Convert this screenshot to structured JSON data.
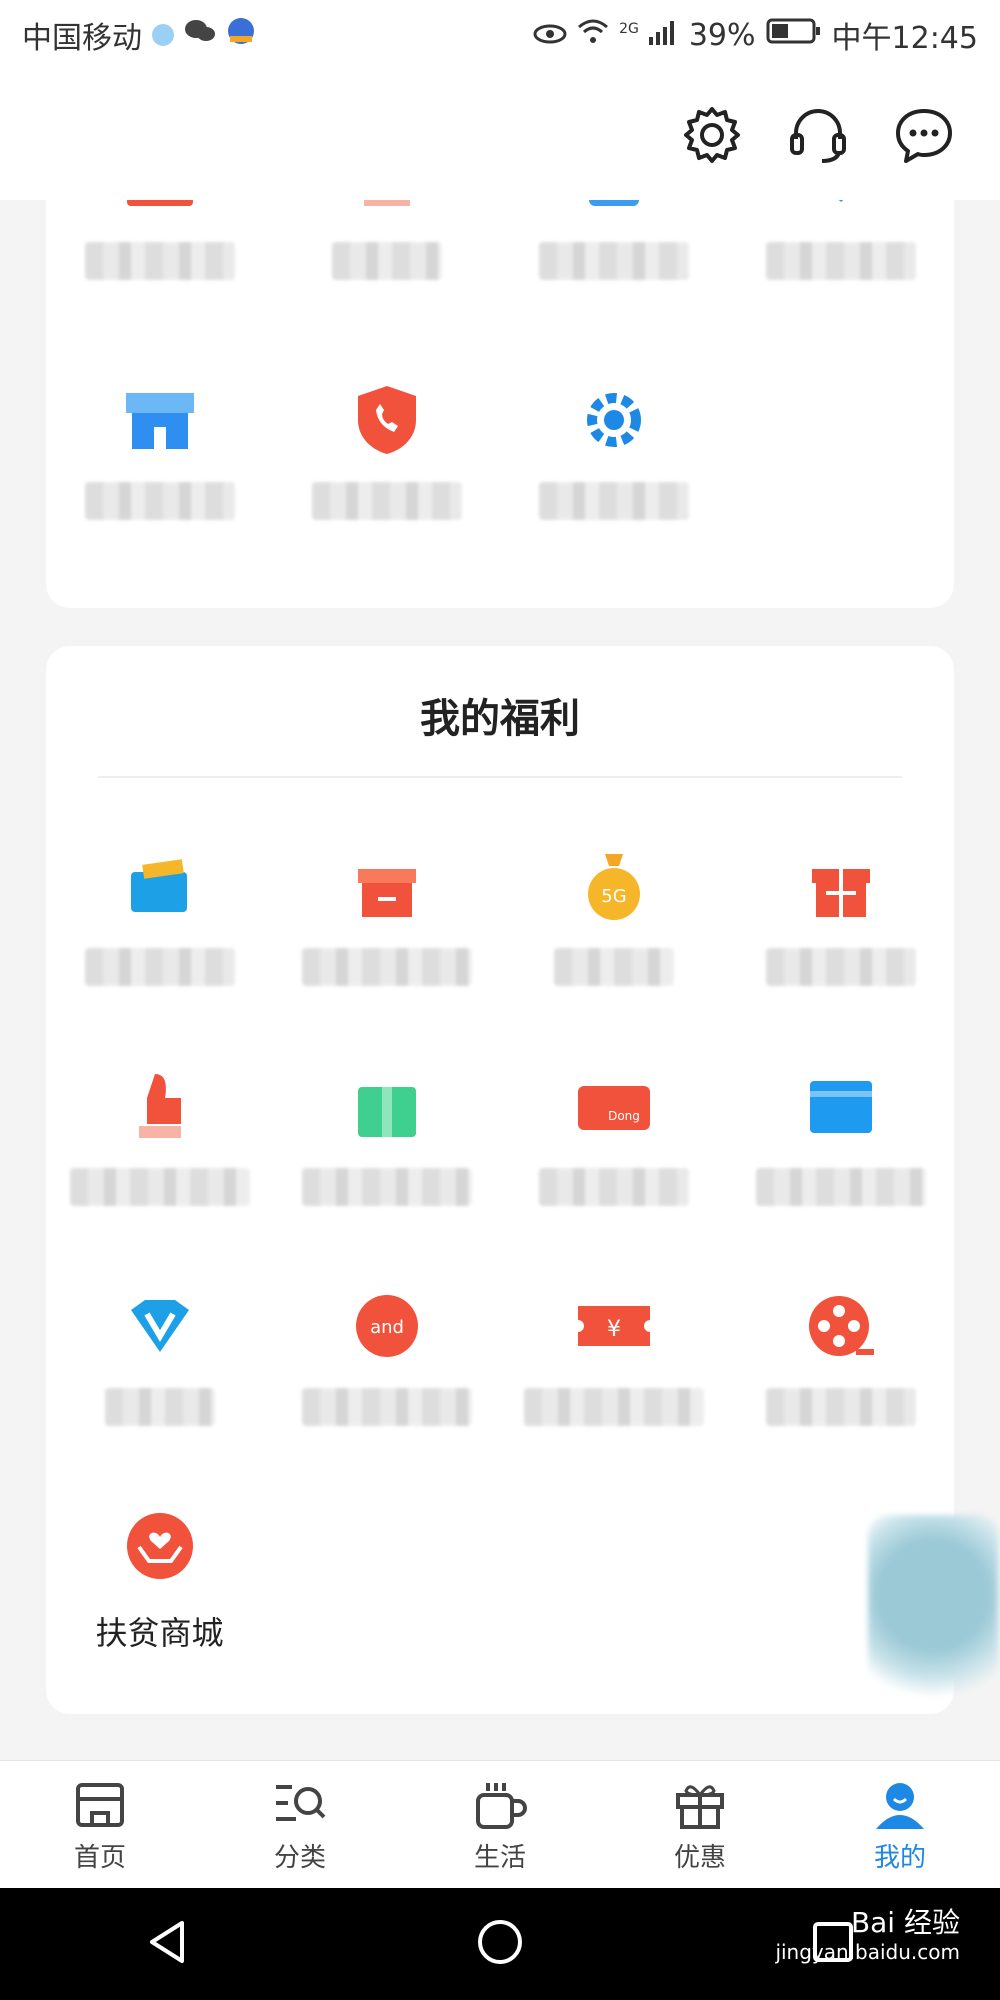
{
  "status_bar": {
    "carrier": "中国移动",
    "network": "2G",
    "battery": "39%",
    "time": "中午12:45"
  },
  "header": {
    "settings_icon": "gear-icon",
    "service_icon": "headset-icon",
    "message_icon": "chat-bubble-icon"
  },
  "welfare": {
    "title": "我的福利",
    "last_item_label": "扶贫商城"
  },
  "tabbar": {
    "items": [
      {
        "label": "首页",
        "icon": "home-icon"
      },
      {
        "label": "分类",
        "icon": "category-search-icon"
      },
      {
        "label": "生活",
        "icon": "coffee-cup-icon"
      },
      {
        "label": "优惠",
        "icon": "gift-icon"
      },
      {
        "label": "我的",
        "icon": "user-icon"
      }
    ],
    "active_index": 4
  },
  "watermark": {
    "brand": "Bai 经验",
    "url": "jingyan.baidu.com"
  },
  "colors": {
    "accent_blue": "#1e88e5",
    "accent_red": "#f0523c",
    "accent_orange": "#f6a623"
  }
}
